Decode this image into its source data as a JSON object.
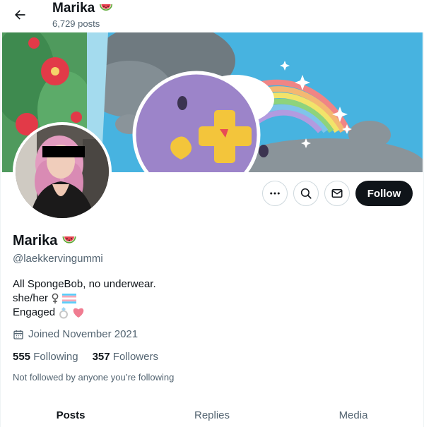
{
  "header": {
    "name": "Marika",
    "posts_count": "6,729 posts"
  },
  "profile": {
    "name": "Marika",
    "handle": "@laekkervingummi",
    "bio": {
      "line1": "All SpongeBob, no underwear.",
      "line2": "she/her",
      "line3": "Engaged"
    },
    "joined": "Joined November 2021",
    "following_count": "555",
    "following_label": "Following",
    "followers_count": "357",
    "followers_label": "Followers",
    "followed_note": "Not followed by anyone you’re following"
  },
  "actions": {
    "follow_label": "Follow"
  },
  "tabs": [
    {
      "label": "Posts"
    },
    {
      "label": "Replies"
    },
    {
      "label": "Media"
    }
  ],
  "icons": {
    "back": "arrow-left-icon",
    "more": "more-horizontal-icon",
    "search": "search-icon",
    "message": "envelope-icon",
    "calendar": "calendar-icon",
    "watermelon": "watermelon-emoji",
    "female_sign": "female-sign-emoji",
    "trans_flag": "trans-flag-emoji",
    "ring": "ring-emoji",
    "heart": "pink-heart-emoji"
  },
  "colors": {
    "text_primary": "#0f1419",
    "text_secondary": "#536471",
    "follow_bg": "#0f1419",
    "border": "#cfd9de"
  }
}
